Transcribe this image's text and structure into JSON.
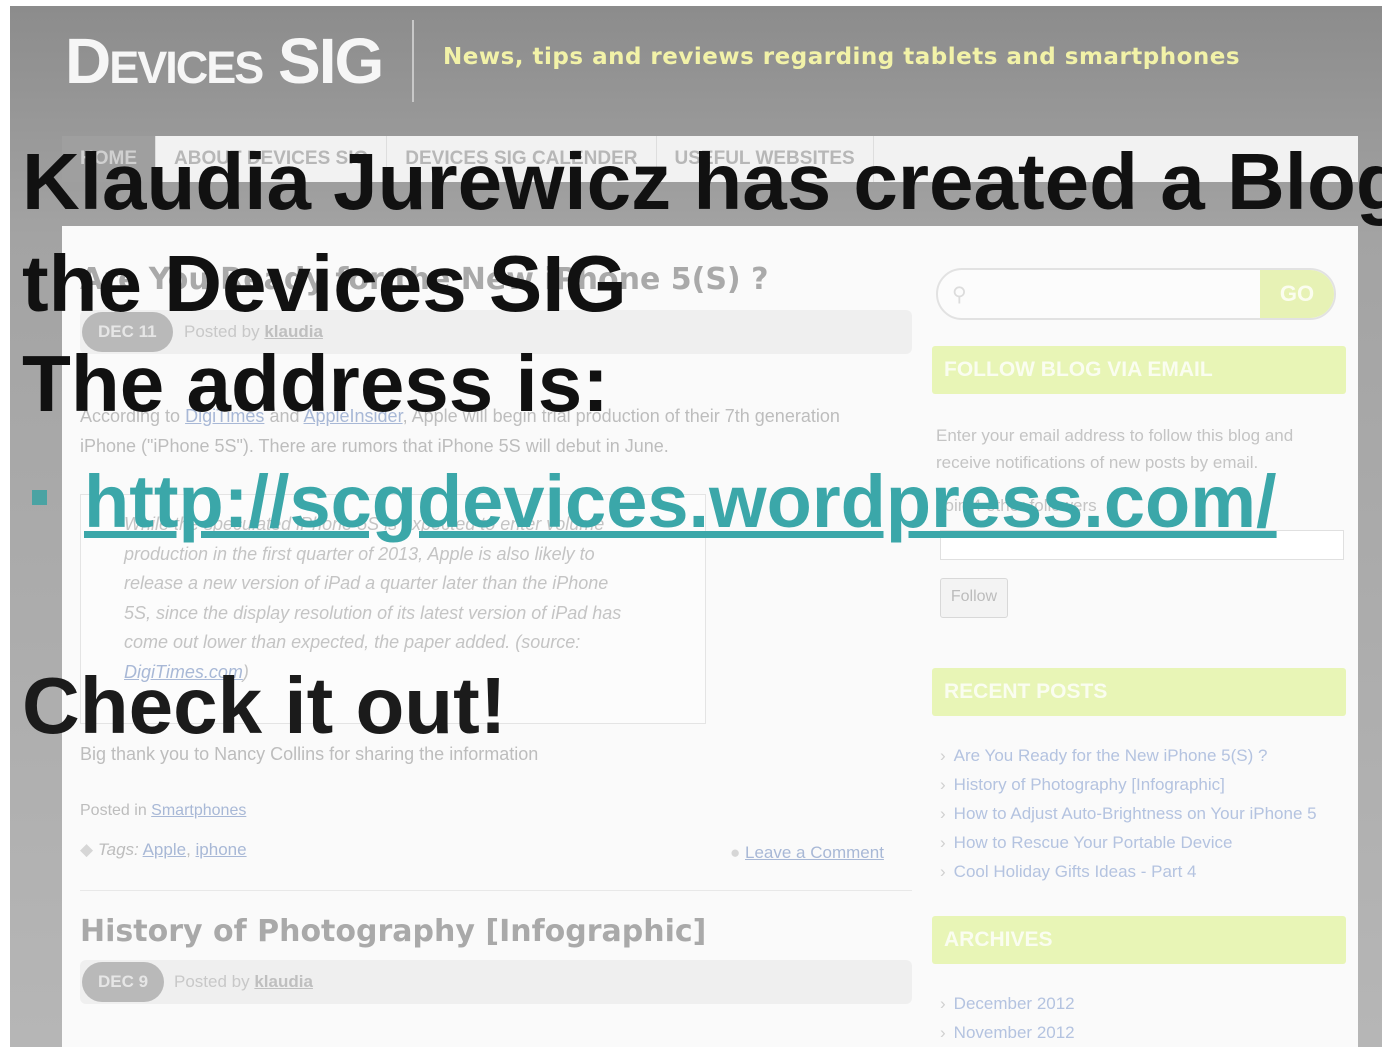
{
  "blog": {
    "logo": "Devices SIG",
    "tagline": "News, tips and reviews regarding tablets and smartphones",
    "nav": [
      {
        "label": "HOME",
        "active": true
      },
      {
        "label": "ABOUT DEVICES SIG",
        "active": false
      },
      {
        "label": "DEVICES SIG CALENDER",
        "active": false
      },
      {
        "label": "USEFUL WEBSITES",
        "active": false
      }
    ],
    "post1": {
      "title": "Are You Ready for the New iPhone 5(S) ?",
      "date": "DEC 11",
      "posted_by_prefix": "Posted by",
      "author": "klaudia",
      "body_line1_prefix": "According to",
      "body_link1": "DigiTimes",
      "body_and": "and",
      "body_link2": "AppleInsider",
      "body_line1_suffix": ", Apple will begin trial production of their 7th generation",
      "body_line2": "iPhone (\"iPhone 5S\"). There are rumors that iPhone 5S will debut in June.",
      "quote_lines": [
        "While the speculated iPhone 5S is expected to enter volume",
        "production in the first quarter of 2013, Apple is also likely to",
        "release a new version of iPad a quarter later than the iPhone",
        "5S, since the display resolution of its latest version of iPad has",
        "come out lower than expected, the paper added. (source:"
      ],
      "quote_source_link": "DigiTimes.com",
      "quote_source_end": ")",
      "thanks": "Big thank you to Nancy Collins for sharing the information",
      "posted_in_prefix": "Posted in",
      "category": "Smartphones",
      "tags_prefix": "Tags:",
      "tags": [
        "Apple",
        "iphone"
      ],
      "tags_separator": ",",
      "comment_link": "Leave a Comment"
    },
    "post2": {
      "title": "History of Photography [Infographic]",
      "date": "DEC 9",
      "posted_by_prefix": "Posted by",
      "author": "klaudia"
    },
    "sidebar": {
      "search_placeholder": "",
      "go_label": "GO",
      "follow_heading": "FOLLOW BLOG VIA EMAIL",
      "follow_text_line1": "Enter your email address to follow this blog and",
      "follow_text_line2": "receive notifications of new posts by email.",
      "followers_text": "Join 4 other followers",
      "follow_button": "Follow",
      "recent_heading": "RECENT POSTS",
      "recent_posts": [
        "Are You Ready for the New iPhone 5(S) ?",
        "History of Photography [Infographic]",
        "How to Adjust Auto-Brightness on Your iPhone 5",
        "How to Rescue Your Portable Device",
        "Cool Holiday Gifts Ideas - Part 4"
      ],
      "archives_heading": "ARCHIVES",
      "archives": [
        "December 2012",
        "November 2012"
      ]
    }
  },
  "slide": {
    "title_line1": "Klaudia Jurewicz has created a Blog for",
    "title_line2": "the Devices SIG",
    "address_label": "The address is:",
    "url": "http://scgdevices.wordpress.com/",
    "check_it_out": "Check it out!"
  }
}
